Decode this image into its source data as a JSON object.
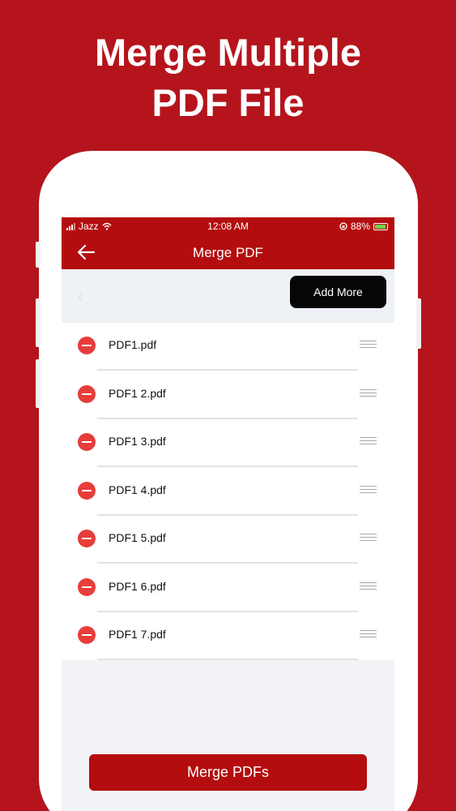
{
  "headline": {
    "line1": "Merge Multiple",
    "line2": "PDF File"
  },
  "status_bar": {
    "carrier": "Jazz",
    "time": "12:08 AM",
    "battery": "88%"
  },
  "nav": {
    "back_icon": "arrow-left-icon",
    "title": "Merge PDF"
  },
  "toolbar": {
    "add_more_label": "Add More"
  },
  "files": [
    {
      "name": "PDF1.pdf"
    },
    {
      "name": "PDF1 2.pdf"
    },
    {
      "name": "PDF1 3.pdf"
    },
    {
      "name": "PDF1 4.pdf"
    },
    {
      "name": "PDF1 5.pdf"
    },
    {
      "name": "PDF1 6.pdf"
    },
    {
      "name": "PDF1 7.pdf"
    }
  ],
  "footer": {
    "merge_label": "Merge PDFs"
  },
  "colors": {
    "brand_red": "#b5141c",
    "remove_red": "#e83d3a",
    "button_black": "#060606"
  }
}
